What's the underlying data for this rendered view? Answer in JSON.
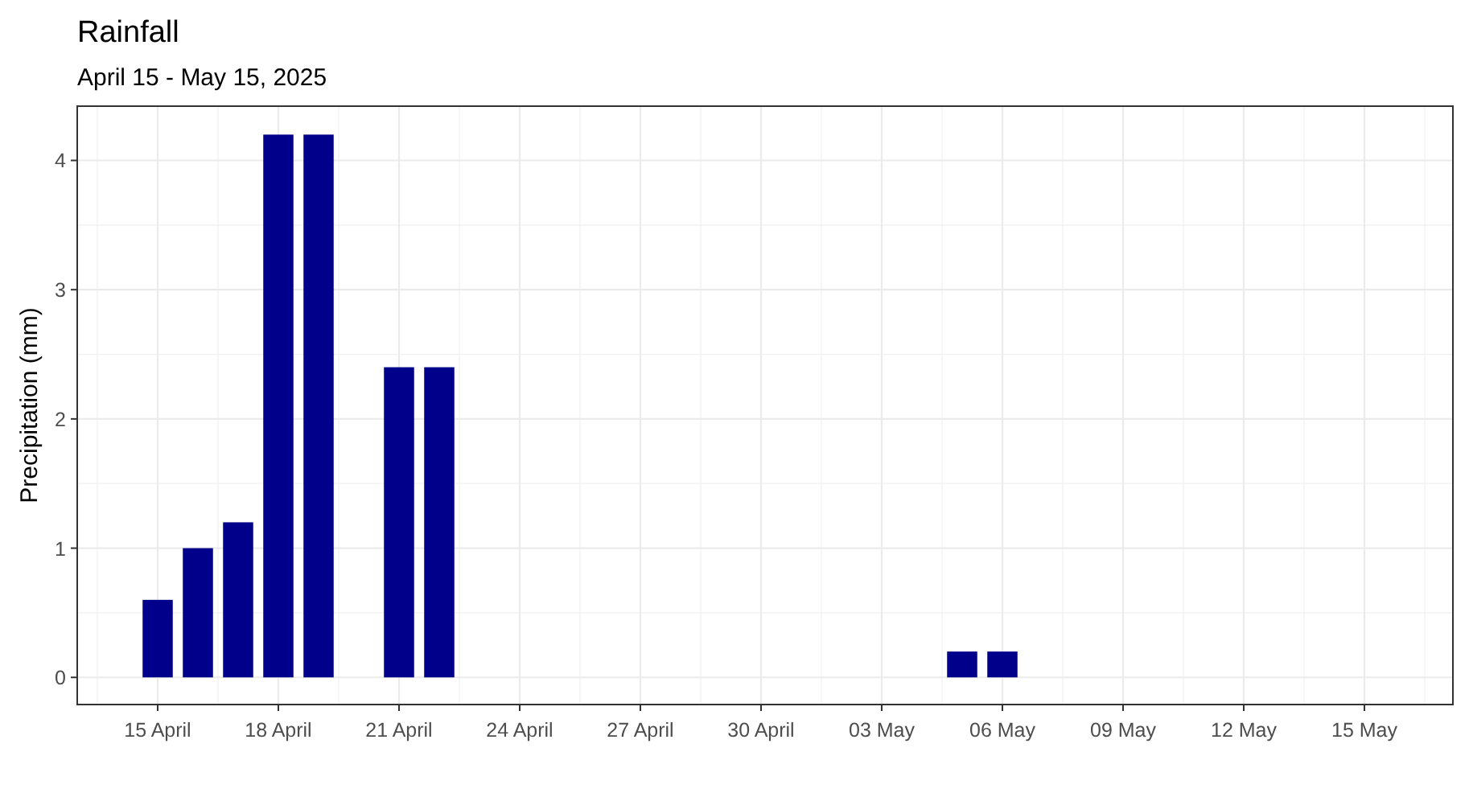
{
  "chart": {
    "title": "Rainfall",
    "subtitle": "April 15 - May 15, 2025",
    "chart_data": {
      "type": "bar",
      "ylabel": "Precipitation (mm)",
      "categories": [
        "15 April",
        null,
        null,
        "18 April",
        null,
        null,
        "21 April",
        null,
        null,
        "24 April",
        null,
        null,
        "27 April",
        null,
        null,
        "30 April",
        null,
        null,
        "03 May",
        null,
        null,
        "06 May",
        null,
        null,
        "09 May",
        null,
        null,
        "12 May",
        null,
        null,
        "15 May"
      ],
      "series": [
        {
          "color": "#00008b",
          "values": [
            0.6,
            1.0,
            1.2,
            4.2,
            4.2,
            null,
            2.4,
            2.4,
            null,
            null,
            null,
            null,
            null,
            null,
            null,
            null,
            null,
            null,
            null,
            null,
            0.2,
            0.2,
            null,
            null,
            null,
            null,
            null,
            null,
            null,
            null,
            null
          ]
        }
      ],
      "ylim": [
        -0.21,
        4.42
      ],
      "yticks": [
        0,
        1,
        2,
        3,
        4
      ],
      "grid": true
    }
  }
}
